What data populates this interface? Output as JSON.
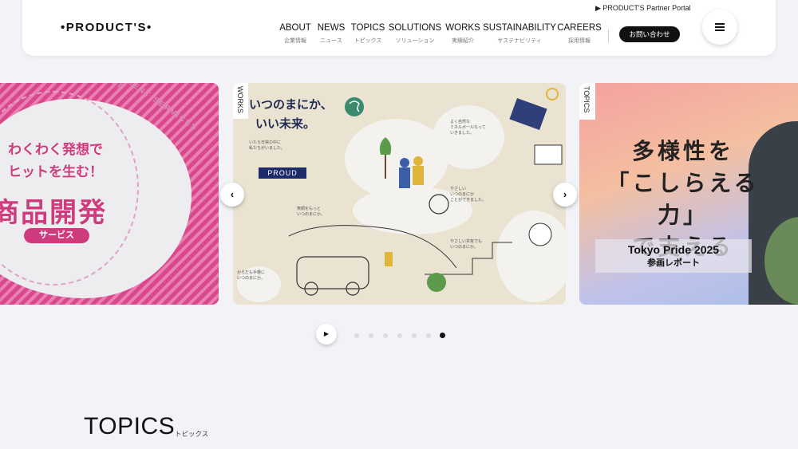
{
  "header": {
    "logo": "•PRODUCT'S•",
    "partner_portal": "▶ PRODUCT'S Partner Portal",
    "nav": [
      {
        "en": "ABOUT",
        "ja": "企業情報"
      },
      {
        "en": "NEWS",
        "ja": "ニュース"
      },
      {
        "en": "TOPICS",
        "ja": "トピックス"
      },
      {
        "en": "SOLUTIONS",
        "ja": "ソリューション"
      },
      {
        "en": "WORKS",
        "ja": "実績紹介"
      },
      {
        "en": "SUSTAINABILITY",
        "ja": "サステナビリティ"
      },
      {
        "en": "CAREERS",
        "ja": "採用情報"
      }
    ],
    "contact_label": "お問い合わせ",
    "menu_icon": "hamburger-icon"
  },
  "slides": {
    "slide1": {
      "line1": "わくわく発想で",
      "line2": "ヒットを生む！",
      "title": "商品開発",
      "pill": "サービス",
      "ring_text": "DEVELOPMENT SERVICES PRODUCT"
    },
    "slide2": {
      "tag": "WORKS",
      "head1": "いつのまにか、",
      "head2": "いい未来。",
      "proud": "PROUD"
    },
    "slide3": {
      "tag": "TOPICS",
      "line1": "多様性を",
      "line2": "「こしらえる力」",
      "line3": "で支える",
      "event": "Tokyo Pride 2025",
      "report": "参画レポート"
    }
  },
  "carousel": {
    "prev_icon": "chevron-left-icon",
    "next_icon": "chevron-right-icon",
    "play_icon": "play-icon",
    "active_dot": 7,
    "dot_count": 7
  },
  "topics": {
    "heading": "TOPICS",
    "sub": "トピックス"
  },
  "colors": {
    "accent_pink": "#d03b7e",
    "navy": "#1e2b6b",
    "background": "#f3f2f6"
  }
}
